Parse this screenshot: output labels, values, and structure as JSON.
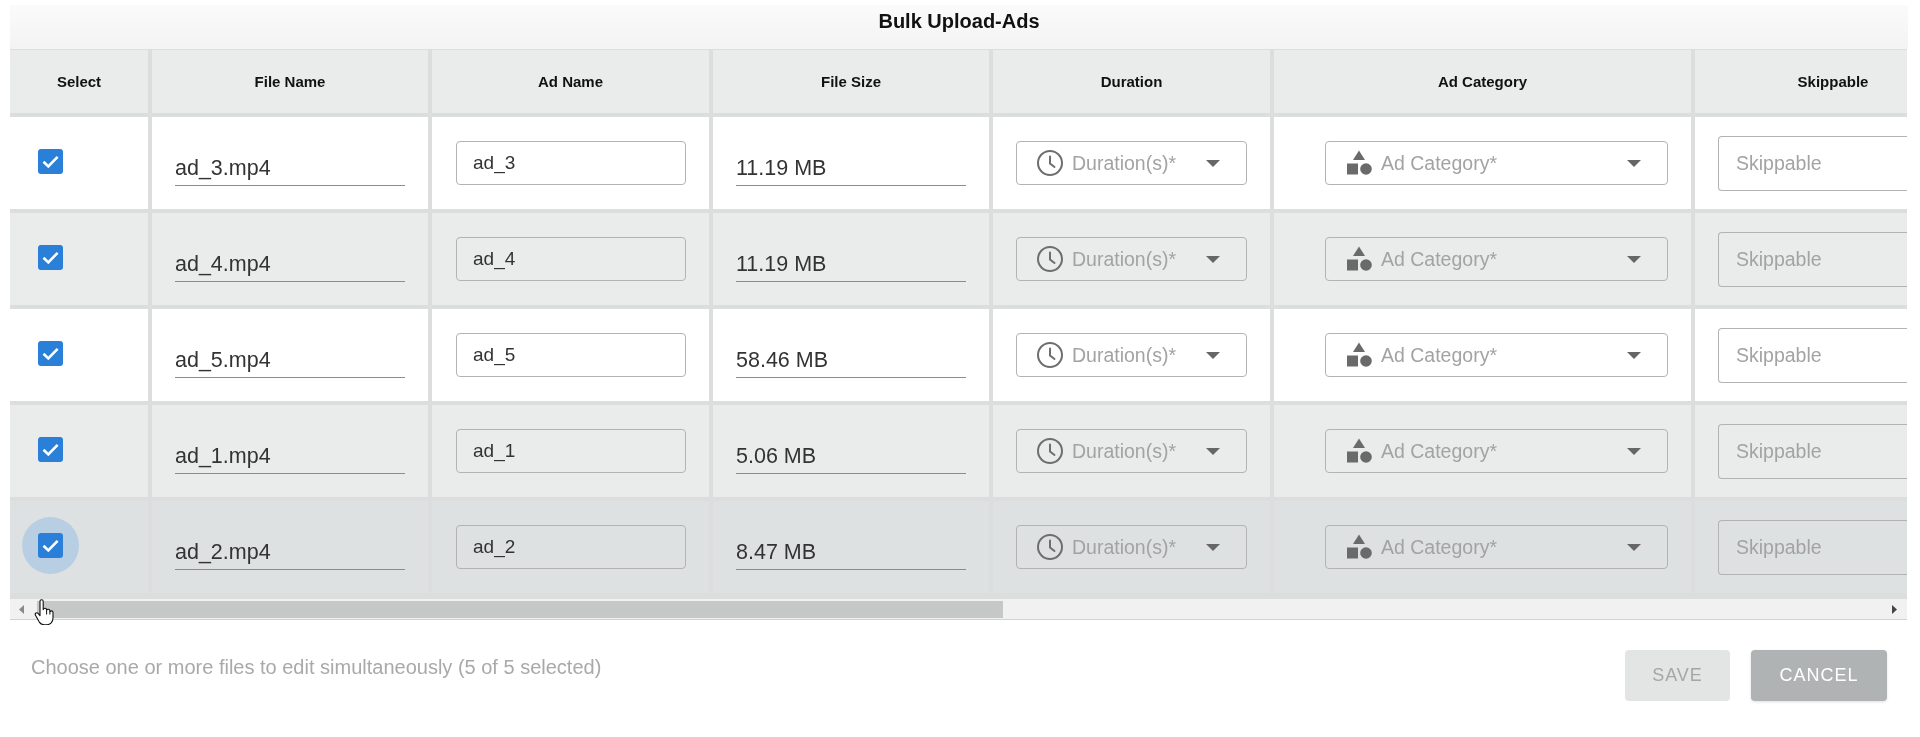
{
  "dialog": {
    "title": "Bulk Upload-Ads"
  },
  "table": {
    "columns": [
      "Select",
      "File Name",
      "Ad Name",
      "File Size",
      "Duration",
      "Ad Category",
      "Skippable"
    ],
    "rows": [
      {
        "selected": true,
        "hovered": false,
        "focused": false,
        "file_name": "ad_3.mp4",
        "ad_name": "ad_3",
        "file_size": "11.19 MB",
        "duration": {
          "placeholder": "Duration(s)*"
        },
        "ad_category": {
          "placeholder": "Ad Category*"
        },
        "skippable": {
          "placeholder": "Skippable"
        }
      },
      {
        "selected": true,
        "hovered": false,
        "focused": false,
        "file_name": "ad_4.mp4",
        "ad_name": "ad_4",
        "file_size": "11.19 MB",
        "duration": {
          "placeholder": "Duration(s)*"
        },
        "ad_category": {
          "placeholder": "Ad Category*"
        },
        "skippable": {
          "placeholder": "Skippable"
        }
      },
      {
        "selected": true,
        "hovered": false,
        "focused": false,
        "file_name": "ad_5.mp4",
        "ad_name": "ad_5",
        "file_size": "58.46 MB",
        "duration": {
          "placeholder": "Duration(s)*"
        },
        "ad_category": {
          "placeholder": "Ad Category*"
        },
        "skippable": {
          "placeholder": "Skippable"
        }
      },
      {
        "selected": true,
        "hovered": false,
        "focused": false,
        "file_name": "ad_1.mp4",
        "ad_name": "ad_1",
        "file_size": "5.06 MB",
        "duration": {
          "placeholder": "Duration(s)*"
        },
        "ad_category": {
          "placeholder": "Ad Category*"
        },
        "skippable": {
          "placeholder": "Skippable"
        }
      },
      {
        "selected": true,
        "hovered": true,
        "focused": true,
        "file_name": "ad_2.mp4",
        "ad_name": "ad_2",
        "file_size": "8.47 MB",
        "duration": {
          "placeholder": "Duration(s)*"
        },
        "ad_category": {
          "placeholder": "Ad Category*"
        },
        "skippable": {
          "placeholder": "Skippable"
        }
      }
    ]
  },
  "footer": {
    "hint": "Choose one or more files to edit simultaneously (5 of 5 selected)",
    "buttons": [
      {
        "label": "SAVE",
        "kind": "secondary",
        "disabled": true
      },
      {
        "label": "CANCEL",
        "kind": "primary",
        "disabled": true
      }
    ]
  }
}
